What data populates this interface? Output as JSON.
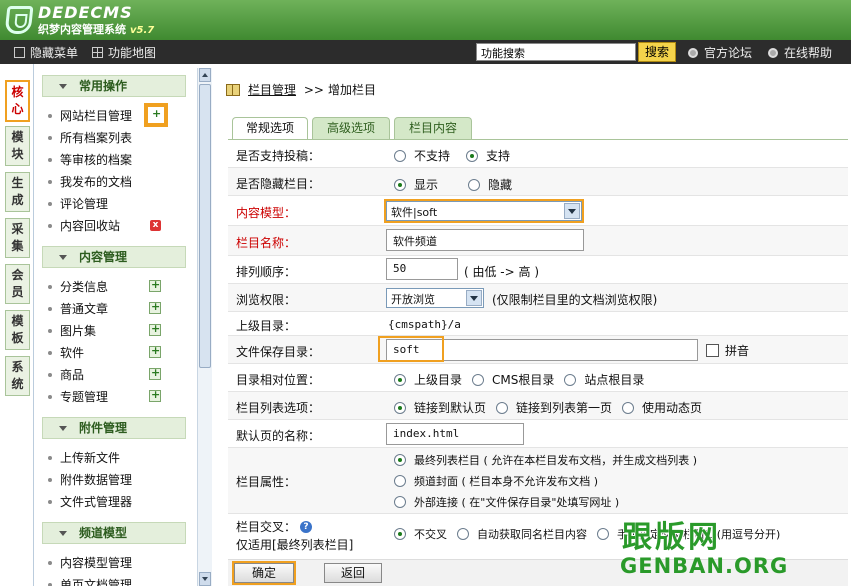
{
  "header": {
    "logo_text": "DEDECMS",
    "logo_sub": "织梦内容管理系统",
    "version": "v5.7"
  },
  "toolbar": {
    "hide_menu": "隐藏菜单",
    "func_map": "功能地图",
    "search_value": "功能搜索",
    "search_btn": "搜索",
    "forum": "官方论坛",
    "help": "在线帮助"
  },
  "vtabs": [
    {
      "label": "核心"
    },
    {
      "label": "模块"
    },
    {
      "label": "生成"
    },
    {
      "label": "采集"
    },
    {
      "label": "会员"
    },
    {
      "label": "模板"
    },
    {
      "label": "系统"
    }
  ],
  "menu": {
    "groups": [
      {
        "title": "常用操作",
        "items": [
          "网站栏目管理",
          "所有档案列表",
          "等审核的档案",
          "我发布的文档",
          "评论管理",
          "内容回收站"
        ]
      },
      {
        "title": "内容管理",
        "items": [
          "分类信息",
          "普通文章",
          "图片集",
          "软件",
          "商品",
          "专题管理"
        ]
      },
      {
        "title": "附件管理",
        "items": [
          "上传新文件",
          "附件数据管理",
          "文件式管理器"
        ]
      },
      {
        "title": "频道模型",
        "items": [
          "内容模型管理",
          "单页文档管理"
        ]
      }
    ]
  },
  "breadcrumb": {
    "link": "栏目管理",
    "sep": ">>",
    "current": "增加栏目"
  },
  "tabs": [
    "常规选项",
    "高级选项",
    "栏目内容"
  ],
  "form": {
    "allow_post": {
      "label": "是否支持投稿：",
      "opt1": "不支持",
      "opt2": "支持"
    },
    "hidden": {
      "label": "是否隐藏栏目：",
      "opt1": "显示",
      "opt2": "隐藏"
    },
    "model": {
      "label": "内容模型：",
      "value": "软件|soft"
    },
    "name": {
      "label": "栏目名称：",
      "value": "软件频道"
    },
    "order": {
      "label": "排列顺序：",
      "value": "50",
      "hint": "( 由低 -> 高 )"
    },
    "perm": {
      "label": "浏览权限：",
      "value": "开放浏览",
      "hint": "(仅限制栏目里的文档浏览权限)"
    },
    "parent": {
      "label": "上级目录：",
      "value": "{cmspath}/a"
    },
    "dir": {
      "label": "文件保存目录：",
      "value": "soft",
      "pinyin": "拼音"
    },
    "relpos": {
      "label": "目录相对位置：",
      "opt1": "上级目录",
      "opt2": "CMS根目录",
      "opt3": "站点根目录"
    },
    "listopt": {
      "label": "栏目列表选项：",
      "opt1": "链接到默认页",
      "opt2": "链接到列表第一页",
      "opt3": "使用动态页"
    },
    "defpage": {
      "label": "默认页的名称：",
      "value": "index.html"
    },
    "attr": {
      "label": "栏目属性：",
      "opt1": "最终列表栏目 ( 允许在本栏目发布文档，并生成文档列表 )",
      "opt2": "频道封面 ( 栏目本身不允许发布文档 )",
      "opt3": "外部连接 ( 在\"文件保存目录\"处填写网址 )"
    },
    "cross": {
      "label": "栏目交叉：",
      "label2": "仅适用[最终列表栏目]",
      "opt1": "不交叉",
      "opt2": "自动获取同名栏目内容",
      "opt3": "手工指定交叉栏目ID(用逗号分开)"
    }
  },
  "buttons": {
    "ok": "确定",
    "back": "返回"
  },
  "watermark": {
    "cn": "跟版网",
    "en": "GENBAN.ORG"
  }
}
